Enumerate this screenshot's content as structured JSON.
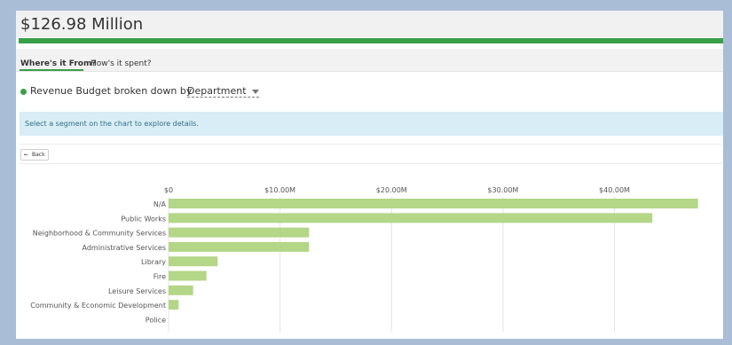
{
  "header": {
    "title": "$126.98 Million"
  },
  "tabs": [
    {
      "label": "Where's it From?"
    },
    {
      "label": "How's it spent?"
    }
  ],
  "heading": {
    "prefix": "Revenue Budget broken down by",
    "dropdown_value": "Department"
  },
  "info": {
    "message": "Select a segment on the chart to explore details."
  },
  "back_button": {
    "label": "Back"
  },
  "colors": {
    "accent": "#3aa048",
    "bar": "#b3d687",
    "info_bg": "#d8edf5"
  },
  "chart_data": {
    "type": "bar",
    "orientation": "horizontal",
    "categories": [
      "N/A",
      "Public Works",
      "Neighborhood & Community Services",
      "Administrative Services",
      "Library",
      "Fire",
      "Leisure Services",
      "Community & Economic Development",
      "Police"
    ],
    "values": [
      47.5,
      43.4,
      12.6,
      12.6,
      4.4,
      3.4,
      2.2,
      0.9,
      0
    ],
    "xlim": [
      0,
      48
    ],
    "x_ticks": [
      0,
      10,
      20,
      30,
      40
    ],
    "x_tick_labels": [
      "$0",
      "$10.00M",
      "$20.00M",
      "$30.00M",
      "$40.00M"
    ],
    "grid": true
  }
}
